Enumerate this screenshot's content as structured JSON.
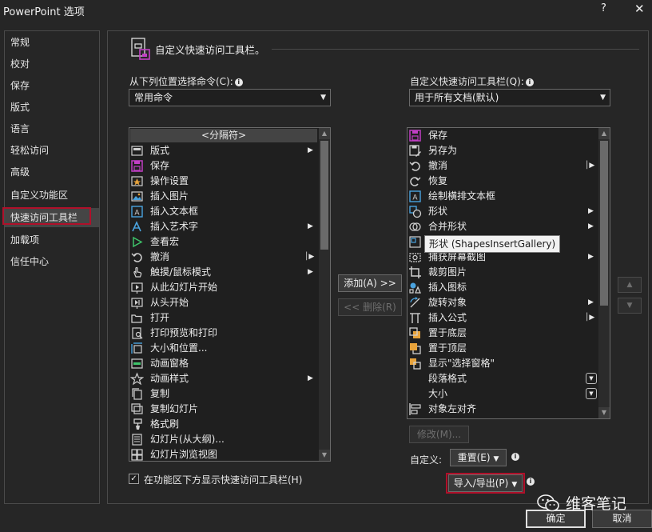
{
  "window": {
    "title": "PowerPoint 选项",
    "help": "?",
    "close": "✕"
  },
  "nav": {
    "items": [
      "常规",
      "校对",
      "保存",
      "版式",
      "语言",
      "轻松访问",
      "高级",
      "自定义功能区",
      "快速访问工具栏",
      "加载项",
      "信任中心"
    ],
    "active": "快速访问工具栏"
  },
  "header": {
    "title": "自定义快速访问工具栏。"
  },
  "left": {
    "label": "从下列位置选择命令(C):",
    "combo_value": "常用命令",
    "items": [
      {
        "label": "<分隔符>",
        "icon": "separator"
      },
      {
        "label": "版式",
        "icon": "layout-icon",
        "sub": "arrow"
      },
      {
        "label": "保存",
        "icon": "save-icon"
      },
      {
        "label": "操作设置",
        "icon": "action-settings-icon"
      },
      {
        "label": "插入图片",
        "icon": "insert-picture-icon"
      },
      {
        "label": "插入文本框",
        "icon": "textbox-icon"
      },
      {
        "label": "插入艺术字",
        "icon": "wordart-icon",
        "sub": "arrow"
      },
      {
        "label": "查看宏",
        "icon": "macro-play-icon"
      },
      {
        "label": "撤消",
        "icon": "undo-icon",
        "sub": "split"
      },
      {
        "label": "触摸/鼠标模式",
        "icon": "touch-mode-icon",
        "sub": "arrow"
      },
      {
        "label": "从此幻灯片开始",
        "icon": "play-from-current-icon"
      },
      {
        "label": "从头开始",
        "icon": "play-from-start-icon"
      },
      {
        "label": "打开",
        "icon": "open-folder-icon"
      },
      {
        "label": "打印预览和打印",
        "icon": "print-preview-icon"
      },
      {
        "label": "大小和位置...",
        "icon": "size-position-icon"
      },
      {
        "label": "动画窗格",
        "icon": "animation-pane-icon"
      },
      {
        "label": "动画样式",
        "icon": "animation-star-icon",
        "sub": "arrow"
      },
      {
        "label": "复制",
        "icon": "copy-icon"
      },
      {
        "label": "复制幻灯片",
        "icon": "duplicate-slide-icon"
      },
      {
        "label": "格式刷",
        "icon": "format-painter-icon"
      },
      {
        "label": "幻灯片(从大纲)...",
        "icon": "slides-from-outline-icon"
      },
      {
        "label": "幻灯片浏览视图",
        "icon": "slide-sorter-icon"
      }
    ]
  },
  "middle": {
    "add": "添加(A) >>",
    "remove": "<< 删除(R)"
  },
  "right": {
    "label": "自定义快速访问工具栏(Q):",
    "combo_value": "用于所有文档(默认)",
    "items": [
      {
        "label": "保存",
        "icon": "save-icon"
      },
      {
        "label": "另存为",
        "icon": "save-as-icon"
      },
      {
        "label": "撤消",
        "icon": "undo-icon",
        "sub": "split"
      },
      {
        "label": "恢复",
        "icon": "redo-icon"
      },
      {
        "label": "绘制横排文本框",
        "icon": "textbox-icon"
      },
      {
        "label": "形状",
        "icon": "shapes-icon",
        "sub": "arrow"
      },
      {
        "label": "合并形状",
        "icon": "merge-shapes-icon",
        "sub": "arrow"
      },
      {
        "label": "",
        "icon": "shapes-gallery-icon"
      },
      {
        "label": "捕获屏幕截图",
        "icon": "screenshot-icon",
        "sub": "arrow"
      },
      {
        "label": "裁剪图片",
        "icon": "crop-icon"
      },
      {
        "label": "插入图标",
        "icon": "insert-icons-icon"
      },
      {
        "label": "旋转对象",
        "icon": "rotate-icon",
        "sub": "arrow"
      },
      {
        "label": "插入公式",
        "icon": "equation-icon",
        "sub": "split"
      },
      {
        "label": "置于底层",
        "icon": "send-to-back-icon"
      },
      {
        "label": "置于顶层",
        "icon": "bring-to-front-icon"
      },
      {
        "label": "显示\"选择窗格\"",
        "icon": "selection-pane-icon"
      },
      {
        "label": "段落格式",
        "icon": "none",
        "sub": "dropdown"
      },
      {
        "label": "大小",
        "icon": "none",
        "sub": "dropdown"
      },
      {
        "label": "对象左对齐",
        "icon": "align-left-icon"
      }
    ],
    "tooltip": "形状 (ShapesInsertGallery)",
    "modify": "修改(M)...",
    "customize_label": "自定义:",
    "reset": "重置(E)",
    "import_export": "导入/导出(P)"
  },
  "checkbox": {
    "label": "在功能区下方显示快速访问工具栏(H)",
    "checked": true
  },
  "footer": {
    "ok": "确定",
    "cancel": "取消"
  },
  "watermark": {
    "text": "维客笔记"
  }
}
